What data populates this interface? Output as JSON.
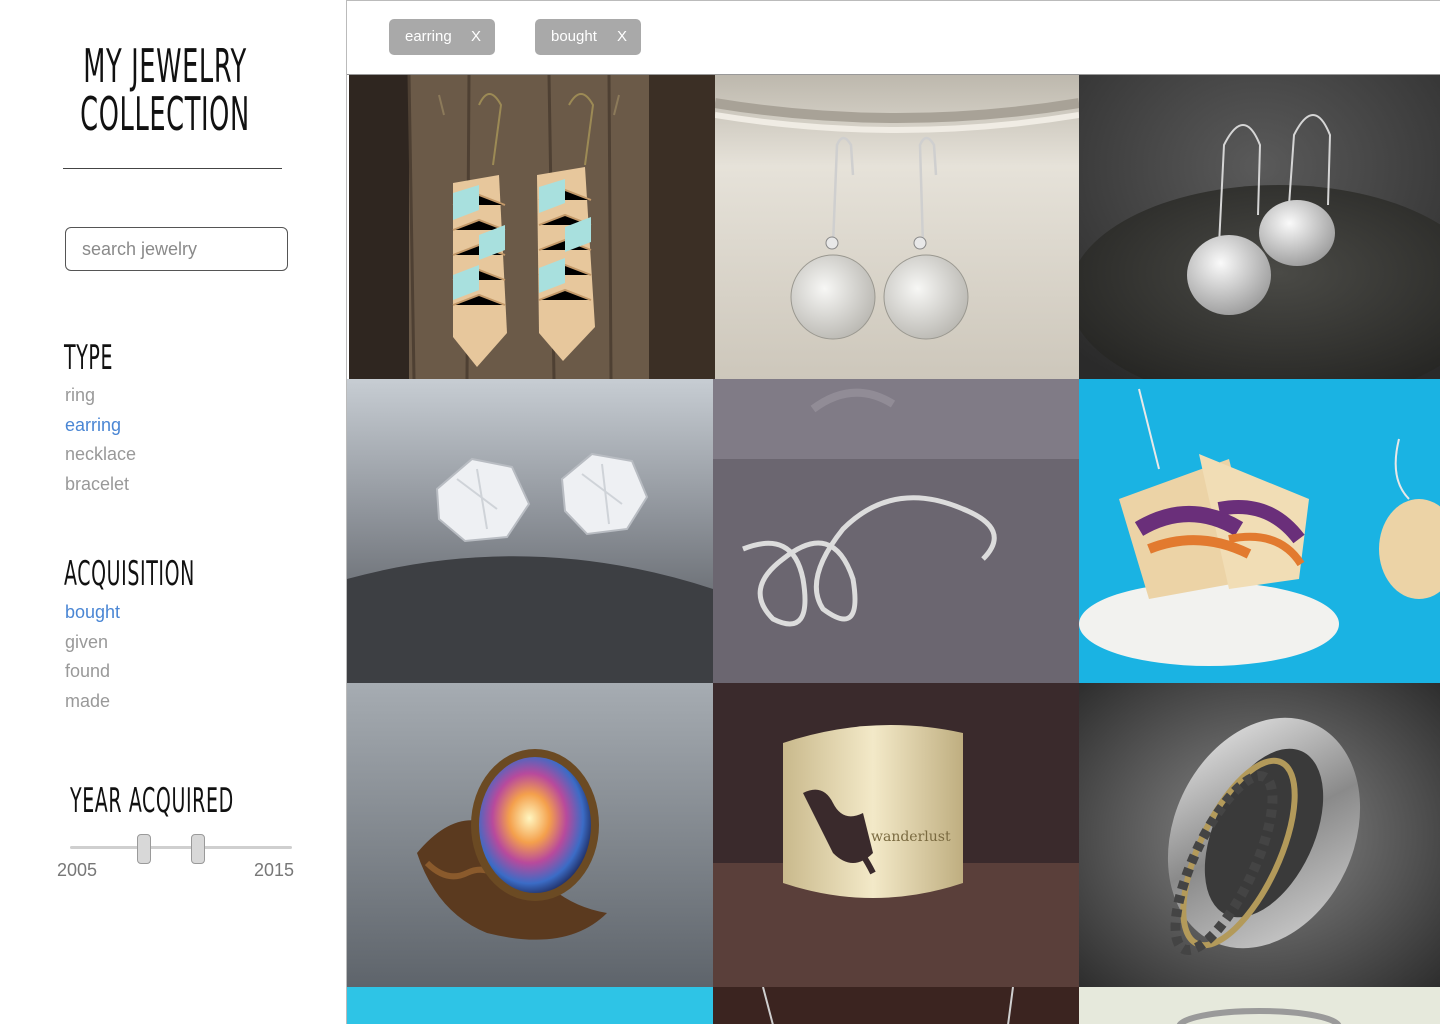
{
  "sidebar": {
    "title_line1": "MY JEWELRY",
    "title_line2": "COLLECTION",
    "search": {
      "placeholder": "search jewelry",
      "value": ""
    },
    "type": {
      "heading": "TYPE",
      "items": [
        {
          "label": "ring",
          "active": false
        },
        {
          "label": "earring",
          "active": true
        },
        {
          "label": "necklace",
          "active": false
        },
        {
          "label": "bracelet",
          "active": false
        }
      ]
    },
    "acquisition": {
      "heading": "ACQUISITION",
      "items": [
        {
          "label": "bought",
          "active": true
        },
        {
          "label": "given",
          "active": false
        },
        {
          "label": "found",
          "active": false
        },
        {
          "label": "made",
          "active": false
        }
      ]
    },
    "year": {
      "heading": "YEAR ACQUIRED",
      "min_label": "2005",
      "max_label": "2015"
    }
  },
  "tags": [
    {
      "label": "earring",
      "close": "X"
    },
    {
      "label": "bought",
      "close": "X"
    }
  ],
  "accent_color": "#4a86d4",
  "gallery": [
    "chevron-wood-earrings",
    "hammered-disc-earrings-cup",
    "hammered-disc-earrings-stone",
    "raw-diamond-stud-earrings",
    "spiral-wire-ring",
    "sandwich-charm-earrings",
    "galaxy-cabochon-ring",
    "world-map-cuff-ring",
    "silver-spinner-ring",
    "turquoise-item",
    "chain-necklace",
    "silver-ring"
  ],
  "cuff_engraving": "wanderlust"
}
